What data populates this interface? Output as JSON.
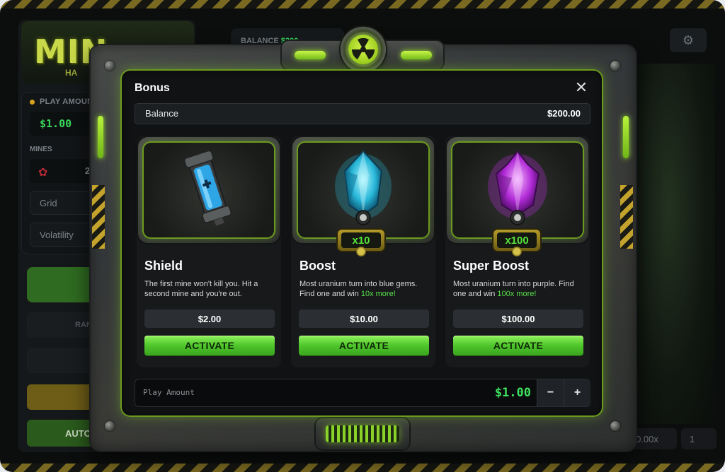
{
  "background": {
    "logo": {
      "text": "MIN",
      "sub": "HA"
    },
    "play_amount": {
      "label": "PLAY AMOUN",
      "value": "$1.00"
    },
    "mines": {
      "label": "MINES",
      "value": "2"
    },
    "grid_label": "Grid",
    "volatility_label": "Volatility",
    "random_label": "RAN",
    "auto_label": "AUTO-P",
    "top_balance": {
      "label": "BALANCE",
      "value": "$200"
    },
    "multiplier": "0.00x",
    "counter": "1"
  },
  "modal": {
    "title": "Bonus",
    "balance": {
      "label": "Balance",
      "value": "$200.00"
    },
    "cards": [
      {
        "title": "Shield",
        "desc": "The first mine won't kill you. Hit a second mine and you're out.",
        "price": "$2.00",
        "button": "ACTIVATE",
        "icon": "shield-capsule-icon"
      },
      {
        "title": "Boost",
        "desc_pre": "Most uranium turn into blue gems. Find one and win ",
        "desc_hl": "10x more!",
        "price": "$10.00",
        "button": "ACTIVATE",
        "badge": "x10",
        "icon": "blue-gem-icon"
      },
      {
        "title": "Super Boost",
        "desc_pre": "Most uranium turn into purple. Find one and win ",
        "desc_hl": "100x more!",
        "price": "$100.00",
        "button": "ACTIVATE",
        "badge": "x100",
        "icon": "purple-gem-icon"
      }
    ],
    "play_amount": {
      "label": "Play Amount",
      "value": "$1.00",
      "minus": "−",
      "plus": "+"
    }
  },
  "colors": {
    "accent_green": "#4fc52c",
    "value_green": "#3ee05f",
    "frame_glow": "#9be22e",
    "hazard_yellow": "#c3a32b"
  }
}
